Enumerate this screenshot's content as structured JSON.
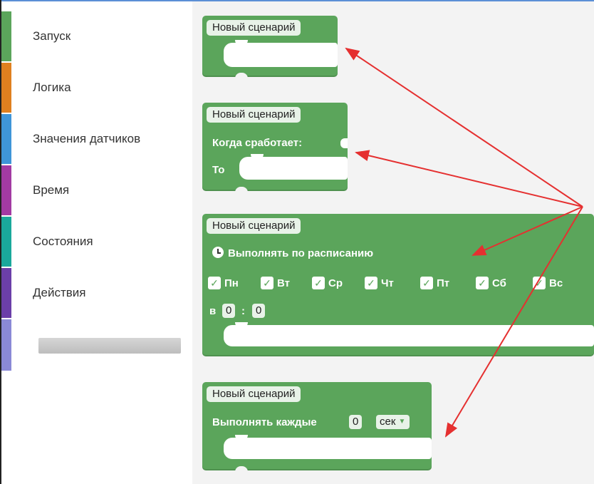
{
  "sidebar": {
    "categories": [
      {
        "label": "Запуск",
        "color": "#5ba55b"
      },
      {
        "label": "Логика",
        "color": "#e0801f"
      },
      {
        "label": "Значения датчиков",
        "color": "#3f95d8"
      },
      {
        "label": "Время",
        "color": "#a33aa3"
      },
      {
        "label": "Состояния",
        "color": "#1aa89b"
      },
      {
        "label": "Действия",
        "color": "#6b3fa8"
      },
      {
        "label": "",
        "color": "#8a89d6"
      }
    ]
  },
  "blocks": {
    "b1": {
      "hat": "Новый сценарий"
    },
    "b2": {
      "hat": "Новый сценарий",
      "when_label": "Когда сработает:",
      "then_label": "То"
    },
    "b3": {
      "hat": "Новый сценарий",
      "schedule_label": "Выполнять по расписанию",
      "days": [
        {
          "label": "Пн",
          "checked": true
        },
        {
          "label": "Вт",
          "checked": true
        },
        {
          "label": "Ср",
          "checked": true
        },
        {
          "label": "Чт",
          "checked": true
        },
        {
          "label": "Пт",
          "checked": true
        },
        {
          "label": "Сб",
          "checked": true
        },
        {
          "label": "Вс",
          "checked": true
        }
      ],
      "at_label": "в",
      "hour": "0",
      "time_sep": ":",
      "minute": "0"
    },
    "b4": {
      "hat": "Новый сценарий",
      "every_label": "Выполнять каждые",
      "every_value": "0",
      "unit": "сек"
    }
  },
  "annotation_color": "#e53030",
  "check_glyph": "✓"
}
